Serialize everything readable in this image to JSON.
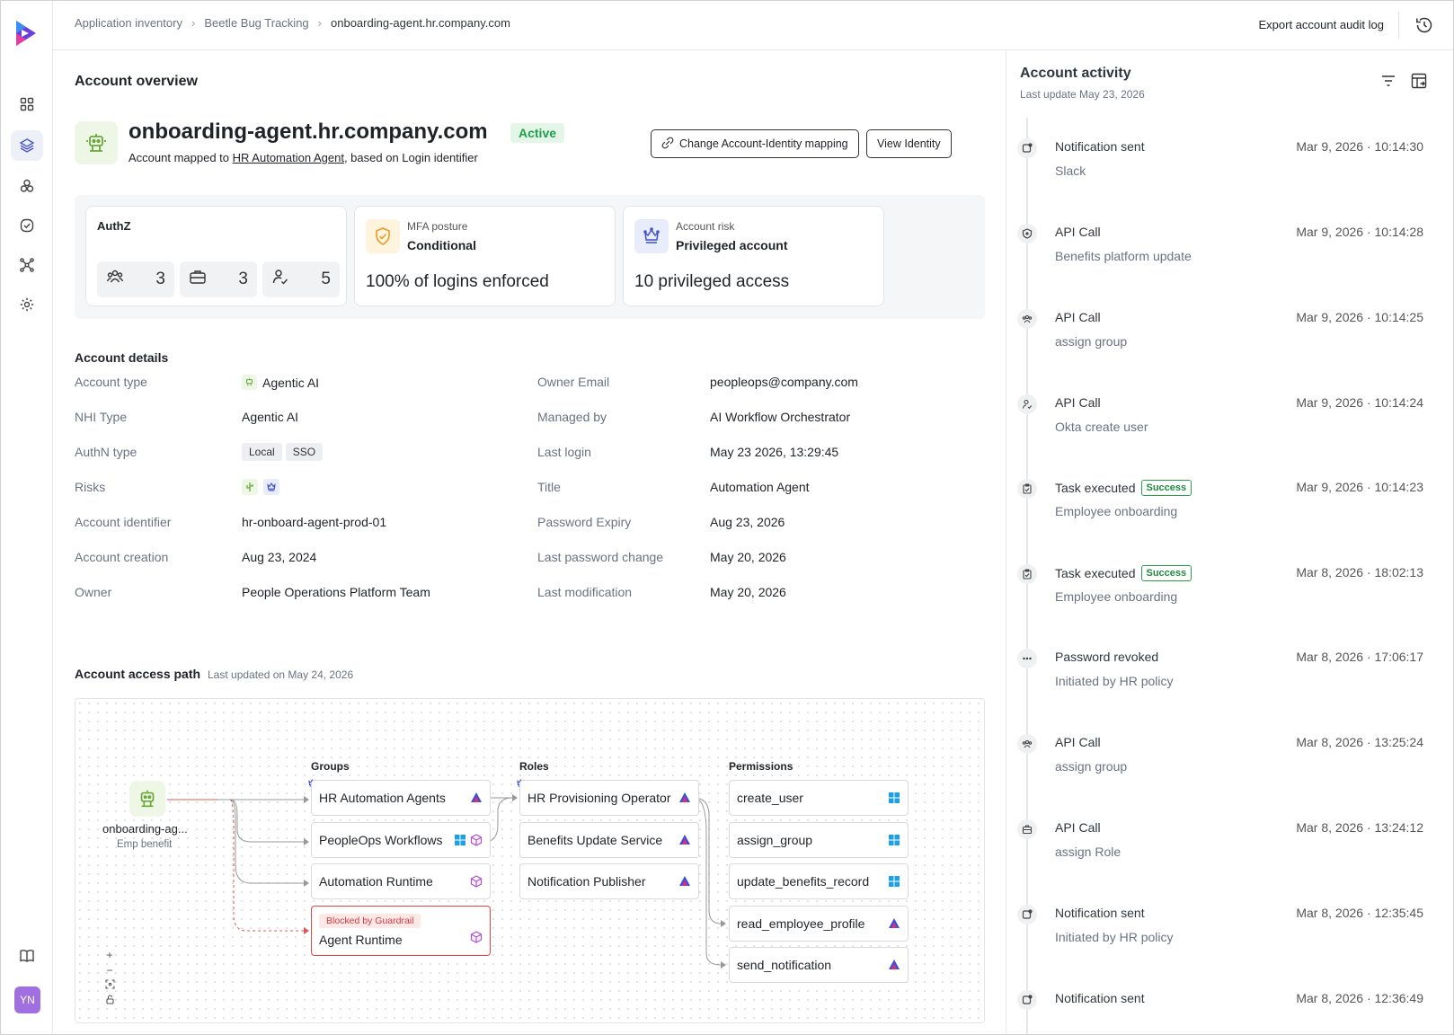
{
  "breadcrumb": {
    "items": [
      "Application inventory",
      "Beetle Bug Tracking",
      "onboarding-agent.hr.company.com"
    ]
  },
  "topbar": {
    "export_label": "Export account audit log"
  },
  "user": {
    "initials": "YN"
  },
  "overview": {
    "heading": "Account overview",
    "account_name": "onboarding-agent.hr.company.com",
    "status": "Active",
    "mapped_prefix": "Account mapped to ",
    "mapped_identity": "HR Automation Agent",
    "mapped_suffix": ", based on Login identifier",
    "change_mapping_label": "Change Account-Identity mapping",
    "view_identity_label": "View Identity"
  },
  "summary": {
    "authz": {
      "title": "AuthZ",
      "groups": "3",
      "roles": "3",
      "users": "5"
    },
    "mfa": {
      "label": "MFA posture",
      "value": "Conditional",
      "detail": "100% of logins enforced"
    },
    "risk": {
      "label": "Account risk",
      "value": "Privileged account",
      "detail": "10 privileged access"
    }
  },
  "details": {
    "heading": "Account details",
    "left": [
      {
        "label": "Account type",
        "value": "Agentic AI"
      },
      {
        "label": "NHI Type",
        "value": "Agentic AI"
      },
      {
        "label": "AuthN type",
        "tags": [
          "Local",
          "SSO"
        ]
      },
      {
        "label": "Risks"
      },
      {
        "label": "Account identifier",
        "value": "hr-onboard-agent-prod-01"
      },
      {
        "label": "Account creation",
        "value": "Aug 23, 2024"
      },
      {
        "label": "Owner",
        "value": "People Operations Platform Team"
      }
    ],
    "right": [
      {
        "label": "Owner Email",
        "value": "peopleops@company.com"
      },
      {
        "label": "Managed by",
        "value": "AI Workflow Orchestrator"
      },
      {
        "label": "Last login",
        "value": "May 23 2026, 13:29:45"
      },
      {
        "label": "Title",
        "value": "Automation Agent"
      },
      {
        "label": "Password Expiry",
        "value": "Aug 23, 2026"
      },
      {
        "label": "Last password change",
        "value": "May 20, 2026"
      },
      {
        "label": "Last modification",
        "value": "May 20, 2026"
      }
    ]
  },
  "access_path": {
    "heading": "Account access path",
    "updated": "Last updated on May 24, 2026",
    "source": {
      "name": "onboarding-ag...",
      "sub": "Emp benefit"
    },
    "groups_header": "Groups",
    "roles_header": "Roles",
    "permissions_header": "Permissions",
    "groups": [
      "HR Automation Agents",
      "PeopleOps Workflows",
      "Automation Runtime",
      "Agent Runtime"
    ],
    "blocked_label": "Blocked by Guardrail",
    "roles": [
      "HR Provisioning Operator",
      "Benefits Update Service",
      "Notification Publisher"
    ],
    "permissions": [
      "create_user",
      "assign_group",
      "update_benefits_record",
      "read_employee_profile",
      "send_notification"
    ],
    "zoom": [
      "+",
      "−"
    ]
  },
  "activity": {
    "title": "Account activity",
    "subtitle": "Last update May 23, 2026",
    "items": [
      {
        "title": "Notification sent",
        "desc": "Slack",
        "time": "Mar 9, 2026 · 10:14:30",
        "icon": "notify-icon"
      },
      {
        "title": "API Call",
        "desc": "Benefits platform update",
        "time": "Mar 9, 2026 · 10:14:28",
        "icon": "shield-icon"
      },
      {
        "title": "API Call",
        "desc": "assign group",
        "time": "Mar 9, 2026 · 10:14:25",
        "icon": "group-icon"
      },
      {
        "title": "API Call",
        "desc": " Okta create user",
        "time": "Mar 9, 2026 · 10:14:24",
        "icon": "user-check-icon"
      },
      {
        "title": "Task executed",
        "badge": "Success",
        "desc": "Employee onboarding",
        "time": "Mar 9, 2026 · 10:14:23",
        "icon": "clipboard-icon"
      },
      {
        "title": "Task executed",
        "badge": "Success",
        "desc": "Employee onboarding",
        "time": "Mar 8, 2026 · 18:02:13",
        "icon": "clipboard-icon"
      },
      {
        "title": "Password revoked",
        "desc": "Initiated by HR policy",
        "time": "Mar 8, 2026 · 17:06:17",
        "icon": "dots-icon"
      },
      {
        "title": "API Call",
        "desc": "assign group",
        "time": "Mar 8, 2026 · 13:25:24",
        "icon": "group-icon"
      },
      {
        "title": "API Call",
        "desc": "assign Role",
        "time": "Mar 8, 2026 · 13:24:12",
        "icon": "briefcase-icon"
      },
      {
        "title": "Notification sent",
        "desc": "Initiated by HR policy",
        "time": "Mar 8, 2026 · 12:35:45",
        "icon": "notify-icon"
      },
      {
        "title": "Notification sent",
        "desc": "",
        "time": "Mar 8, 2026 · 12:36:49",
        "icon": "notify-icon"
      }
    ]
  },
  "colors": {
    "accent": "#4a55c7",
    "success": "#1f9d4a",
    "danger": "#e04545",
    "brand": "#7b3fe4"
  }
}
